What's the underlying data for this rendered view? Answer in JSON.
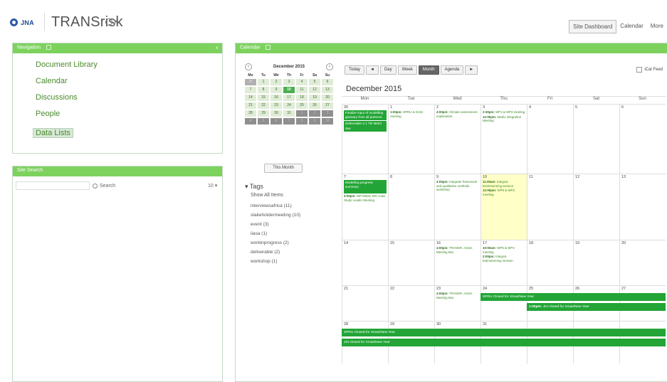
{
  "header": {
    "logo_text": "JNA",
    "site_title": "TRANSrisk",
    "nav": [
      "Site Dashboard",
      "Calendar",
      "More"
    ]
  },
  "navigation": {
    "title": "Navigation",
    "items": [
      "Document Library",
      "Calendar",
      "Discussions",
      "People",
      "Data Lists"
    ],
    "selected": "Data Lists"
  },
  "site_search": {
    "title": "Site Search",
    "button": "Search",
    "count": "10"
  },
  "calendar": {
    "title": "Calendar",
    "mini": {
      "month": "December 2015",
      "dows": [
        "Mo",
        "Tu",
        "We",
        "Th",
        "Fr",
        "Sa",
        "Su"
      ],
      "days": [
        "30",
        "1",
        "2",
        "3",
        "4",
        "5",
        "6",
        "7",
        "8",
        "9",
        "10",
        "11",
        "12",
        "13",
        "14",
        "15",
        "16",
        "17",
        "18",
        "19",
        "20",
        "21",
        "22",
        "23",
        "24",
        "25",
        "26",
        "27",
        "28",
        "29",
        "30",
        "31",
        "1",
        "2",
        "3",
        "4",
        "5",
        "6",
        "7",
        "8",
        "9",
        "10"
      ]
    },
    "this_month": "This Month",
    "tags_title": "Tags",
    "show_all": "Show All Items",
    "tags": [
      "interviewsafrica (11)",
      "stakeholdermeeting (10)",
      "event (3)",
      "iiasa (1)",
      "workinprogress (2)",
      "deliverable (2)",
      "workshop (1)"
    ],
    "toolbar": {
      "today": "Today",
      "prev": "◄",
      "day": "Day",
      "week": "Week",
      "month": "Month",
      "agenda": "Agenda",
      "next": "►"
    },
    "ical": "iCal Feed",
    "heading": "December 2015",
    "dows": [
      "Mon",
      "Tue",
      "Wed",
      "Thu",
      "Fri",
      "Sat",
      "Sun"
    ],
    "events": {
      "w1_mon_a": "Finalize input of modelling glossary from all partners",
      "w1_mon_b": "Deliverable 2.1 7th Metro due",
      "w1_tue_time": "1:00pm:",
      "w1_tue_text": "SPRU & DJ15 meeting",
      "w1_wed_time": "4:00pm:",
      "w1_wed_text": "Climate assessment explanation",
      "w1_thu_a_time": "2:30pm:",
      "w1_thu_a_text": "WP1 & WP3 meeting",
      "w1_thu_b_time": "12:00pm:",
      "w1_thu_b_text": "Matrix integration Meeting",
      "w2_mon_a": "Modelling progress summary",
      "w2_mon_b_time": "4:00pm:",
      "w2_mon_b_text": "WP Matrix WG Case Study Leader Meeting",
      "w2_wed_time": "4:00pm:",
      "w2_wed_text": "Integrate framework and qualitative methods workshop",
      "w2_thu_a_time": "11:00am:",
      "w2_thu_a_text": "Integrat. Brainstorming session",
      "w2_thu_b_time": "12:00pm:",
      "w2_thu_b_text": "WP5 & WP3 meeting",
      "w3_wed_time": "4:00pm:",
      "w3_wed_text": "TRANSR. Action Meeting Bus",
      "w3_thu_a_time": "10:00am:",
      "w3_thu_a_text": "WP5 & WP3 meeting",
      "w3_thu_b_time": "2:00pm:",
      "w3_thu_b_text": "Integrat. brainstorming session",
      "w4_wed_time": "4:00pm:",
      "w4_wed_text": "TRANSR. Action Meeting Bus",
      "w4_span_a": "SPRU Closed for Xmas/New Year",
      "w4_span_b_time": "1:00pm:",
      "w4_span_b_text": "JIH closed for Xmas/New Year",
      "w5_span_a": "SPRU Closed for Xmas/New Year",
      "w5_span_b": "JIH closed for Xmas/New Year"
    },
    "weeks": [
      [
        "30",
        "1",
        "2",
        "3",
        "4",
        "5",
        "6"
      ],
      [
        "7",
        "8",
        "9",
        "10",
        "11",
        "12",
        "13"
      ],
      [
        "14",
        "15",
        "16",
        "17",
        "18",
        "19",
        "20"
      ],
      [
        "21",
        "22",
        "23",
        "24",
        "25",
        "26",
        "27"
      ],
      [
        "28",
        "29",
        "30",
        "31",
        "",
        "",
        ""
      ]
    ]
  },
  "colors": {
    "accent_green": "#7dd25e",
    "event_green": "#22a536",
    "link_green": "#4b8b2d",
    "today_yellow": "#ffffc8"
  }
}
